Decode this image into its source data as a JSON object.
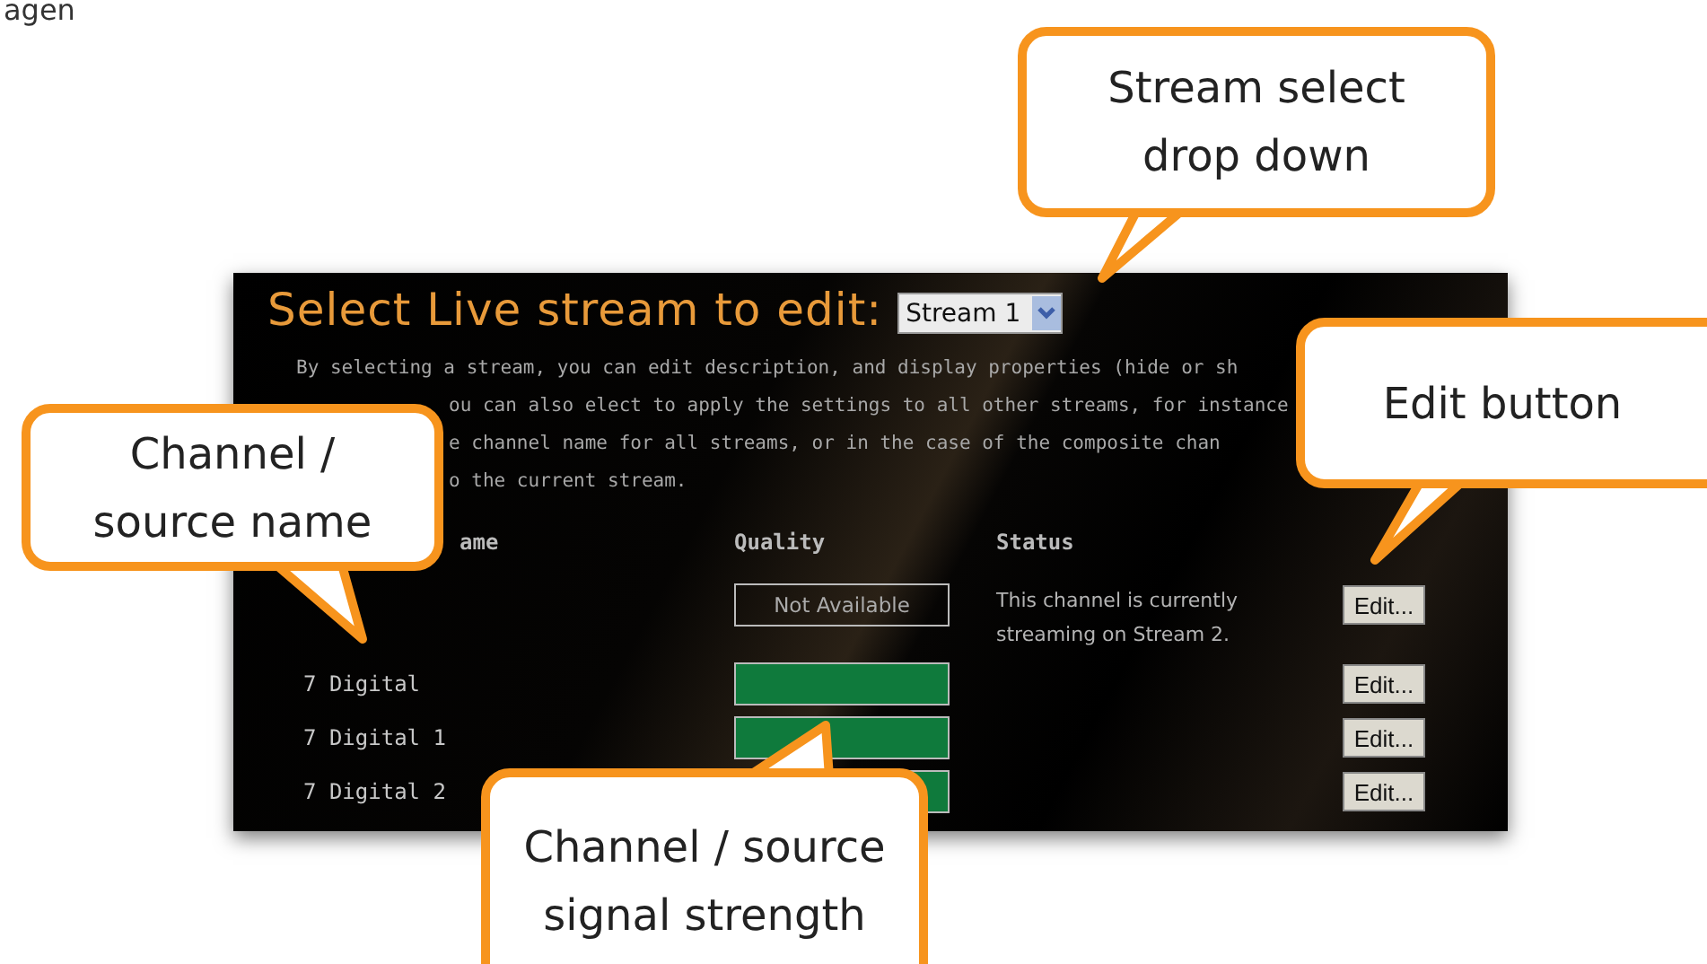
{
  "page_fragment": "agen",
  "panel": {
    "title": "Select Live stream to edit:",
    "stream_select": {
      "value": "Stream 1"
    },
    "description_lines": [
      "By selecting a stream, you can edit description, and display properties (hide or sh",
      "ou can also elect to apply the settings to all other streams, for instance",
      "e channel name for all streams, or in the case of the composite chan",
      "o the current stream."
    ],
    "columns": [
      "ame",
      "Quality",
      "Status"
    ],
    "rows": [
      {
        "name": "",
        "kind": "unavailable",
        "quality_text": "Not Available",
        "status": "This channel is currently streaming on Stream 2.",
        "button": "Edit..."
      },
      {
        "name": "7 Digital",
        "kind": "meter",
        "level": 1,
        "status": "",
        "button": "Edit..."
      },
      {
        "name": "7 Digital 1",
        "kind": "meter",
        "level": 1,
        "status": "",
        "button": "Edit..."
      },
      {
        "name": "7 Digital 2",
        "kind": "meter",
        "level": 1,
        "status": "",
        "button": "Edit..."
      }
    ]
  },
  "callouts": [
    {
      "text": "Stream select drop down",
      "kind": "down"
    },
    {
      "text": "Channel / source name",
      "kind": "down"
    },
    {
      "text": "Edit button",
      "kind": "down"
    },
    {
      "text": "Channel / source signal strength",
      "kind": "up"
    }
  ]
}
